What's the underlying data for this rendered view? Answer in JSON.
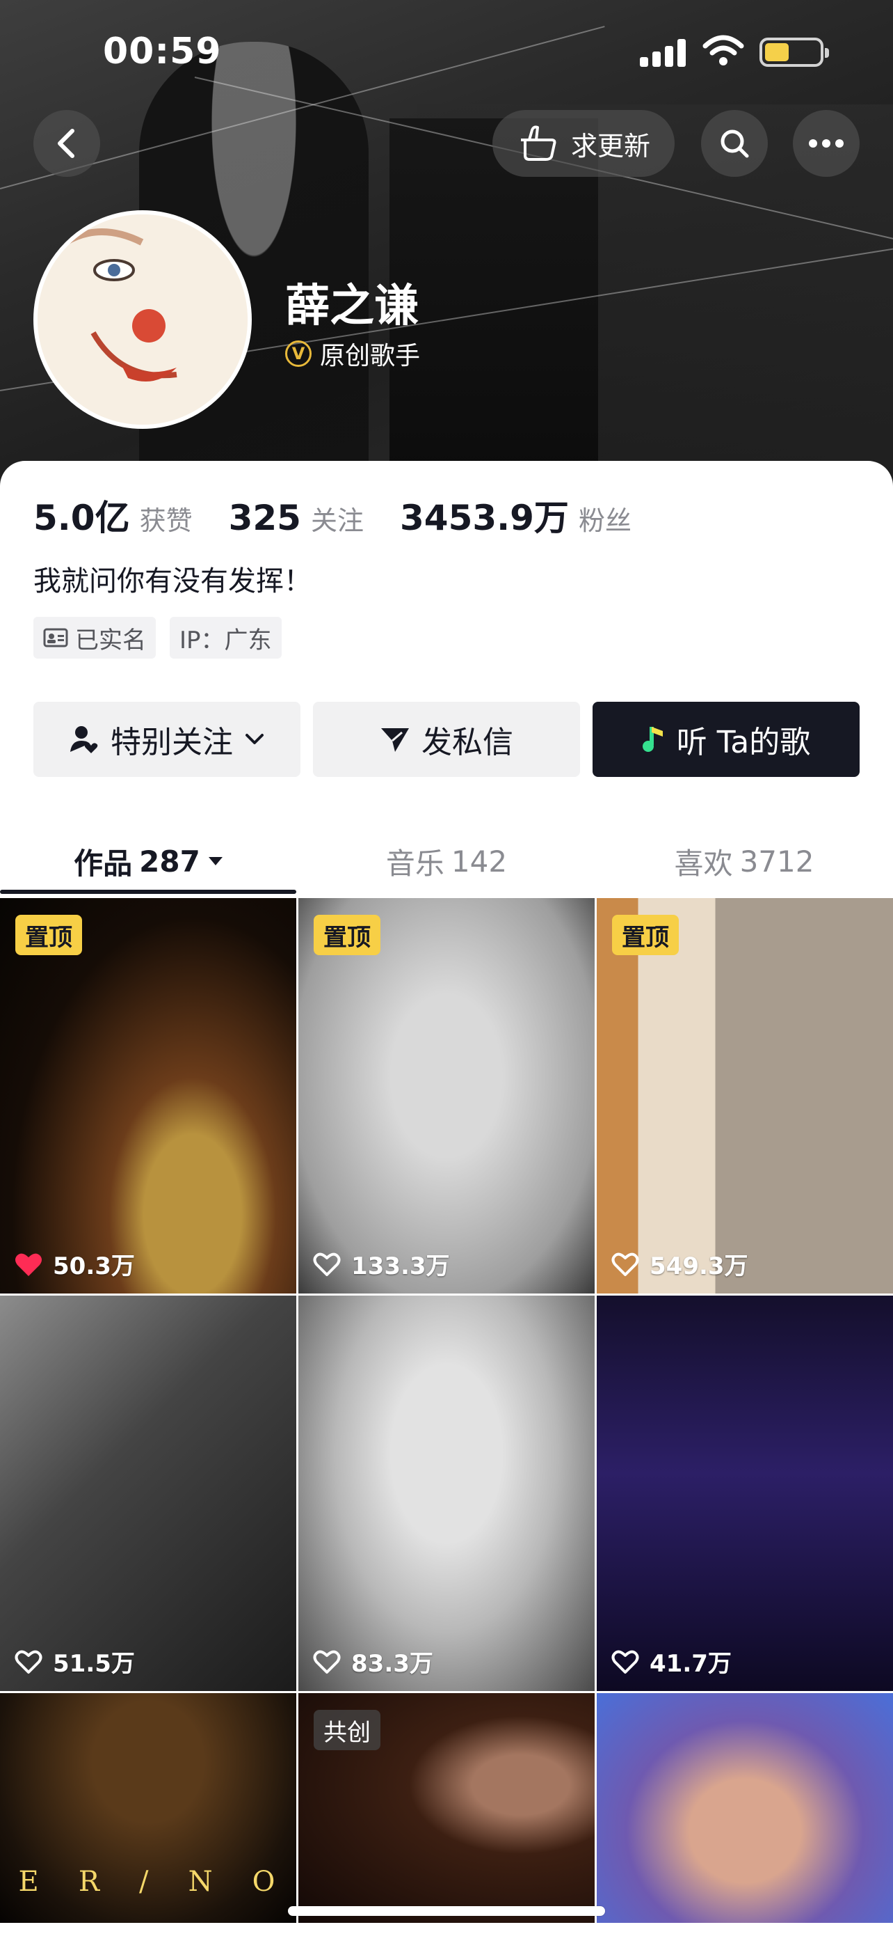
{
  "status_bar": {
    "time": "00:59"
  },
  "header": {
    "request_update_label": "求更新",
    "name": "薛之谦",
    "verify_badge": "V",
    "verify_title": "原创歌手"
  },
  "stats": [
    {
      "value": "5.0亿",
      "label": "获赞"
    },
    {
      "value": "325",
      "label": "关注"
    },
    {
      "value": "3453.9万",
      "label": "粉丝"
    }
  ],
  "bio": "我就问你有没有发挥！",
  "tags": [
    {
      "icon": "id-card-icon",
      "text": "已实名"
    },
    {
      "icon": "",
      "text": "IP：广东"
    }
  ],
  "actions": {
    "follow": "特别关注",
    "message": "发私信",
    "music": "听 Ta的歌"
  },
  "tabs": [
    {
      "label": "作品",
      "count": "287",
      "active": true
    },
    {
      "label": "音乐",
      "count": "142",
      "active": false
    },
    {
      "label": "喜欢",
      "count": "3712",
      "active": false
    }
  ],
  "grid": [
    {
      "badge": "置顶",
      "likes": "50.3万",
      "liked": true
    },
    {
      "badge": "置顶",
      "likes": "133.3万",
      "liked": false
    },
    {
      "badge": "置顶",
      "likes": "549.3万",
      "liked": false
    },
    {
      "badge": "",
      "likes": "51.5万",
      "liked": false
    },
    {
      "badge": "",
      "likes": "83.3万",
      "liked": false
    },
    {
      "badge": "",
      "likes": "41.7万",
      "liked": false
    },
    {
      "badge": "",
      "likes": "",
      "overlay": [
        "E",
        "R",
        "/",
        "N",
        "O"
      ]
    },
    {
      "badge": "共创",
      "likes": ""
    },
    {
      "badge": "",
      "likes": ""
    }
  ],
  "colors": {
    "accent_badge": "#f7cf46",
    "like_red": "#fe2c55",
    "dark_button": "#161823"
  }
}
